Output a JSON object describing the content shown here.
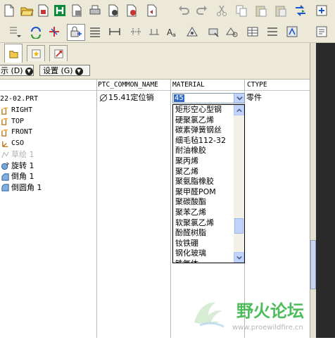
{
  "toolbar_top": {
    "icons": [
      "new-icon",
      "open-icon",
      "save-icon",
      "save-copy-icon",
      "print-icon",
      "print-setup-icon",
      "email-icon",
      "undo-icon",
      "redo-icon",
      "cut-icon",
      "copy-icon",
      "paste-icon",
      "paste-special-icon",
      "regenerate-icon",
      "sync-icon"
    ]
  },
  "toolbar_second": {
    "icons": [
      "datum-dropdown-icon",
      "reorient-icon",
      "datum-axis-icon",
      "display-lock-icon",
      "list-icon",
      "dimension-icon",
      "spacing-icon",
      "text-icon",
      "annotation-icon",
      "view-icon",
      "table-icon",
      "grid-icon",
      "model-icon"
    ]
  },
  "menubar": {
    "show_label": "示 (D)",
    "settings_label": "设置 (G)"
  },
  "columns": {
    "name": "PTC_COMMON_NAME",
    "material": "MATERIAL",
    "ctype": "CTYPE"
  },
  "tree": {
    "root": "22-02.PRT",
    "items": [
      {
        "label": "RIGHT",
        "icon": "datum-plane-icon",
        "mono": true,
        "suppressed": false
      },
      {
        "label": "TOP",
        "icon": "datum-plane-icon",
        "mono": true,
        "suppressed": false
      },
      {
        "label": "FRONT",
        "icon": "datum-plane-icon",
        "mono": true,
        "suppressed": false
      },
      {
        "label": "CSO",
        "icon": "coordinate-system-icon",
        "mono": true,
        "suppressed": false
      },
      {
        "label": "草绘 1",
        "icon": "sketch-icon",
        "mono": false,
        "suppressed": true
      },
      {
        "label": "旋转 1",
        "icon": "revolve-icon",
        "mono": false,
        "suppressed": false
      },
      {
        "label": "倒角 1",
        "icon": "chamfer-icon",
        "mono": false,
        "suppressed": false
      },
      {
        "label": "倒圆角 1",
        "icon": "round-icon",
        "mono": false,
        "suppressed": false
      }
    ]
  },
  "row": {
    "name": "15.41定位销",
    "material_value": "45",
    "ctype": "零件"
  },
  "dropdown": {
    "options": [
      "矩形空心型钢",
      "硬聚氯乙烯",
      "碳素弹簧钢丝",
      "细毛毡112-32",
      "耐油橡胶",
      "聚丙烯",
      "聚乙烯",
      "聚氨脂橡胶",
      "聚甲醛POM",
      "聚碳酸酯",
      "聚苯乙烯",
      "软聚氯乙烯",
      "酚醛树脂",
      "钕铁硼",
      "钢化玻璃",
      "铁氧体"
    ],
    "scroll_fraction": 0.85
  },
  "watermark": {
    "title": "野火论坛",
    "url": "www.proewildfire.cn"
  },
  "colors": {
    "toolbar": "#ece9d8",
    "selection": "#316ac5",
    "scroll": "#c1d3fb",
    "watermark": "#3bb54a"
  }
}
